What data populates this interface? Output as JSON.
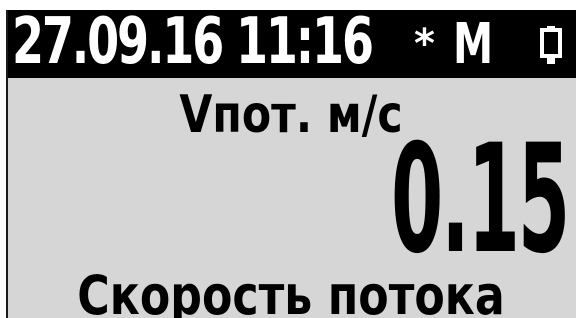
{
  "status_bar": {
    "datetime": "27.09.16 11:16",
    "star_symbol": "*",
    "mode": "M",
    "battery_icon": "battery-icon"
  },
  "measurement": {
    "label": "Vпот. м/с",
    "value": "0.15",
    "caption": "Скорость потока"
  },
  "colors": {
    "lcd_background": "#d6d6d6",
    "status_bar_background": "#000000",
    "text": "#000000",
    "status_text": "#ffffff"
  }
}
